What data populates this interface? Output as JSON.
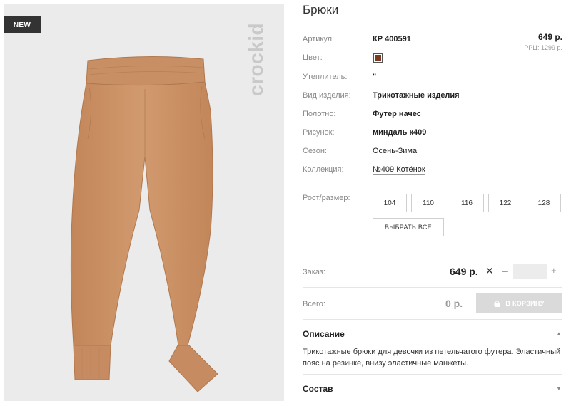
{
  "image": {
    "badge": "NEW",
    "brand_watermark": "crockid",
    "background_color": "#ebebeb",
    "product_color": "#c98f64"
  },
  "product": {
    "title": "Брюки",
    "price": "649 р.",
    "rrp": "РРЦ: 1299 р.",
    "swatch_color": "#7a3b23",
    "attributes": [
      {
        "label": "Артикул:",
        "value": "КР 400591"
      },
      {
        "label": "Цвет:",
        "value": ""
      },
      {
        "label": "Утеплитель:",
        "value": "\""
      },
      {
        "label": "Вид изделия:",
        "value": "Трикотажные изделия"
      },
      {
        "label": "Полотно:",
        "value": "Футер начес"
      },
      {
        "label": "Рисунок:",
        "value": "миндаль к409"
      },
      {
        "label": "Сезон:",
        "value": "Осень-Зима"
      },
      {
        "label": "Коллекция:",
        "value": "№409 Котёнок"
      }
    ]
  },
  "sizes": {
    "label": "Рост/размер:",
    "options": [
      "104",
      "110",
      "116",
      "122",
      "128"
    ],
    "select_all": "ВЫБРАТЬ ВСЕ"
  },
  "order": {
    "label": "Заказ:",
    "price": "649 р.",
    "times": "✕",
    "minus": "–",
    "plus": "+",
    "quantity": ""
  },
  "total": {
    "label": "Всего:",
    "value": "0 р.",
    "cart_button": "В КОРЗИНУ"
  },
  "sections": {
    "description_title": "Описание",
    "description_text": "Трикотажные брюки для девочки из петельчатого футера. Эластичный пояс на резинке, внизу эластичные манжеты.",
    "composition_title": "Состав",
    "arrow_up": "▲",
    "arrow_down": "▼"
  }
}
